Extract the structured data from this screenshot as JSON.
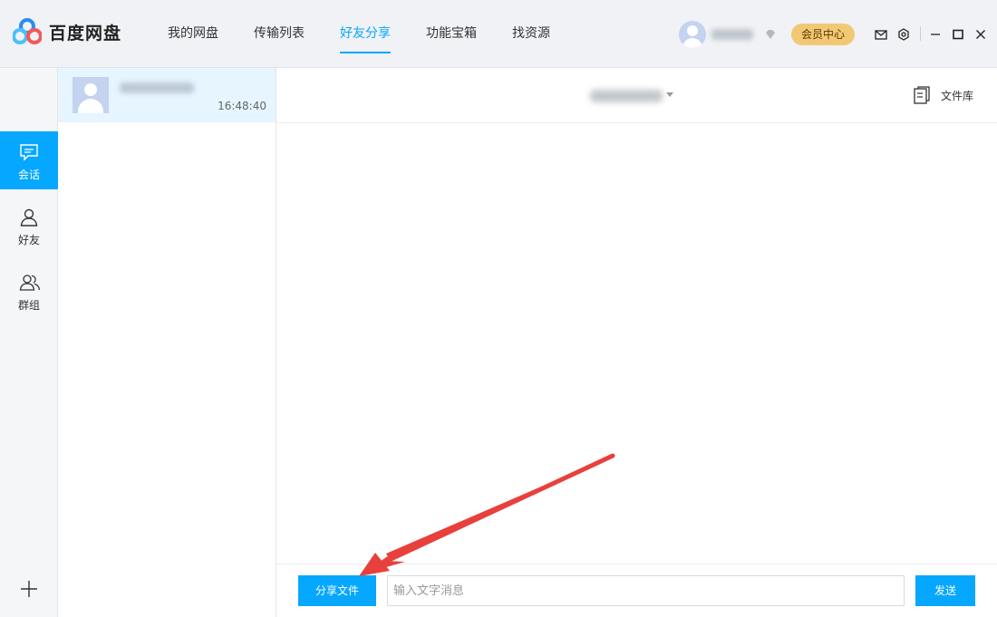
{
  "app": {
    "title": "百度网盘"
  },
  "nav": {
    "items": [
      {
        "label": "我的网盘"
      },
      {
        "label": "传输列表"
      },
      {
        "label": "好友分享",
        "active": true
      },
      {
        "label": "功能宝箱"
      },
      {
        "label": "找资源"
      }
    ]
  },
  "header": {
    "vip_label": "会员中心"
  },
  "rail": {
    "items": [
      {
        "label": "会话",
        "icon": "chat-icon",
        "active": true
      },
      {
        "label": "好友",
        "icon": "user-icon"
      },
      {
        "label": "群组",
        "icon": "group-icon"
      }
    ]
  },
  "conversations": [
    {
      "time": "16:48:40"
    }
  ],
  "chat": {
    "file_library_label": "文件库",
    "share_button_label": "分享文件",
    "input_placeholder": "输入文字消息",
    "send_button_label": "发送"
  },
  "colors": {
    "accent": "#06a7ff",
    "vip": "#f3c875",
    "annotation_arrow": "#e8403c"
  }
}
